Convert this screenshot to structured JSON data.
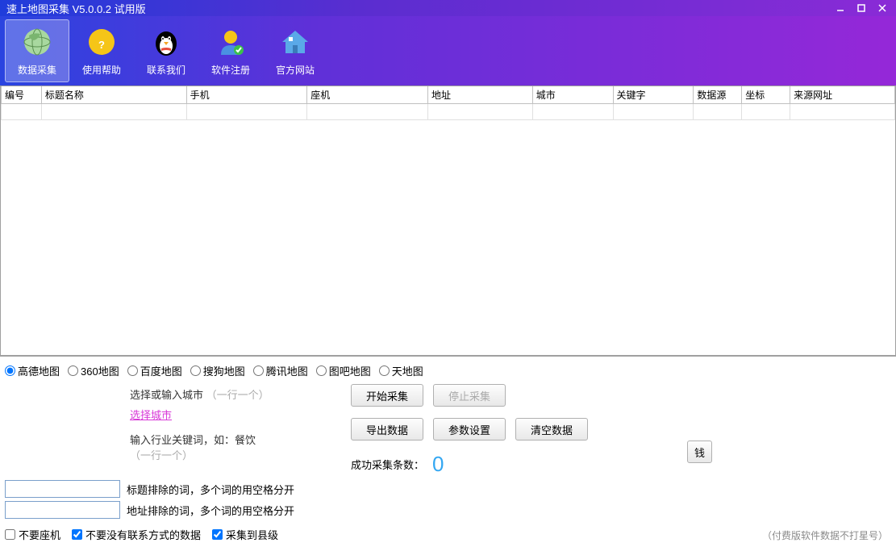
{
  "title": "速上地图采集 V5.0.0.2 试用版",
  "toolbar": [
    {
      "label": "数据采集",
      "icon": "globe",
      "active": true
    },
    {
      "label": "使用帮助",
      "icon": "help",
      "active": false
    },
    {
      "label": "联系我们",
      "icon": "penguin",
      "active": false
    },
    {
      "label": "软件注册",
      "icon": "user",
      "active": false
    },
    {
      "label": "官方网站",
      "icon": "home",
      "active": false
    }
  ],
  "columns": [
    "编号",
    "标题名称",
    "手机",
    "座机",
    "地址",
    "城市",
    "关键字",
    "数据源",
    "坐标",
    "来源网址"
  ],
  "maps": [
    "高德地图",
    "360地图",
    "百度地图",
    "搜狗地图",
    "腾讯地图",
    "图吧地图",
    "天地图"
  ],
  "city": {
    "label": "选择或输入城市",
    "hint": "（一行一个）",
    "select": "选择城市"
  },
  "keyword": {
    "label": "输入行业关键词，如：餐饮",
    "hint": "（一行一个）"
  },
  "exclude": {
    "title": "标题排除的词，多个词的用空格分开",
    "addr": "地址排除的词，多个词的用空格分开"
  },
  "checks": {
    "noLandline": "不要座机",
    "noContact": "不要没有联系方式的数据",
    "toCounty": "采集到县级"
  },
  "buttons": {
    "start": "开始采集",
    "stop": "停止采集",
    "export": "导出数据",
    "params": "参数设置",
    "clear": "清空数据",
    "money": "钱"
  },
  "success": {
    "label": "成功采集条数：",
    "count": "0"
  },
  "footer": "（付费版软件数据不打星号）"
}
